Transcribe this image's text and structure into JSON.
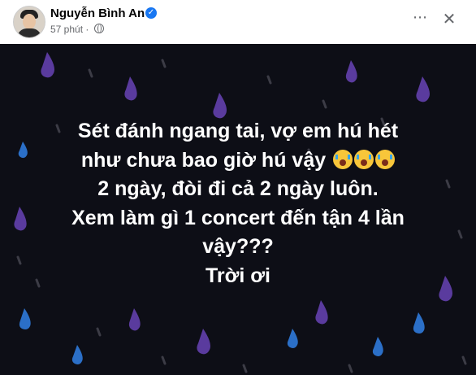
{
  "author": {
    "name": "Nguyễn Bình An",
    "verified_glyph": "✓",
    "time": "57 phút",
    "privacy_icon": "globe-icon"
  },
  "actions": {
    "more_glyph": "⋯",
    "close_glyph": "✕"
  },
  "post": {
    "background_color": "#0d0e16",
    "drop_colors": [
      "#5a3b9e",
      "#2b6fc7",
      "#4a4a55"
    ],
    "lines": [
      "Sét đánh ngang tai, vợ em hú hét",
      "như chưa bao giờ hú vậy",
      "2 ngày, đòi đi cả 2 ngày luôn.",
      "Xem làm gì 1 concert đến tận 4 lần",
      "vậy???",
      "Trời ơi"
    ],
    "emoji": [
      "loudly-crying-face-emoji",
      "loudly-crying-face-emoji",
      "loudly-crying-face-emoji"
    ]
  }
}
